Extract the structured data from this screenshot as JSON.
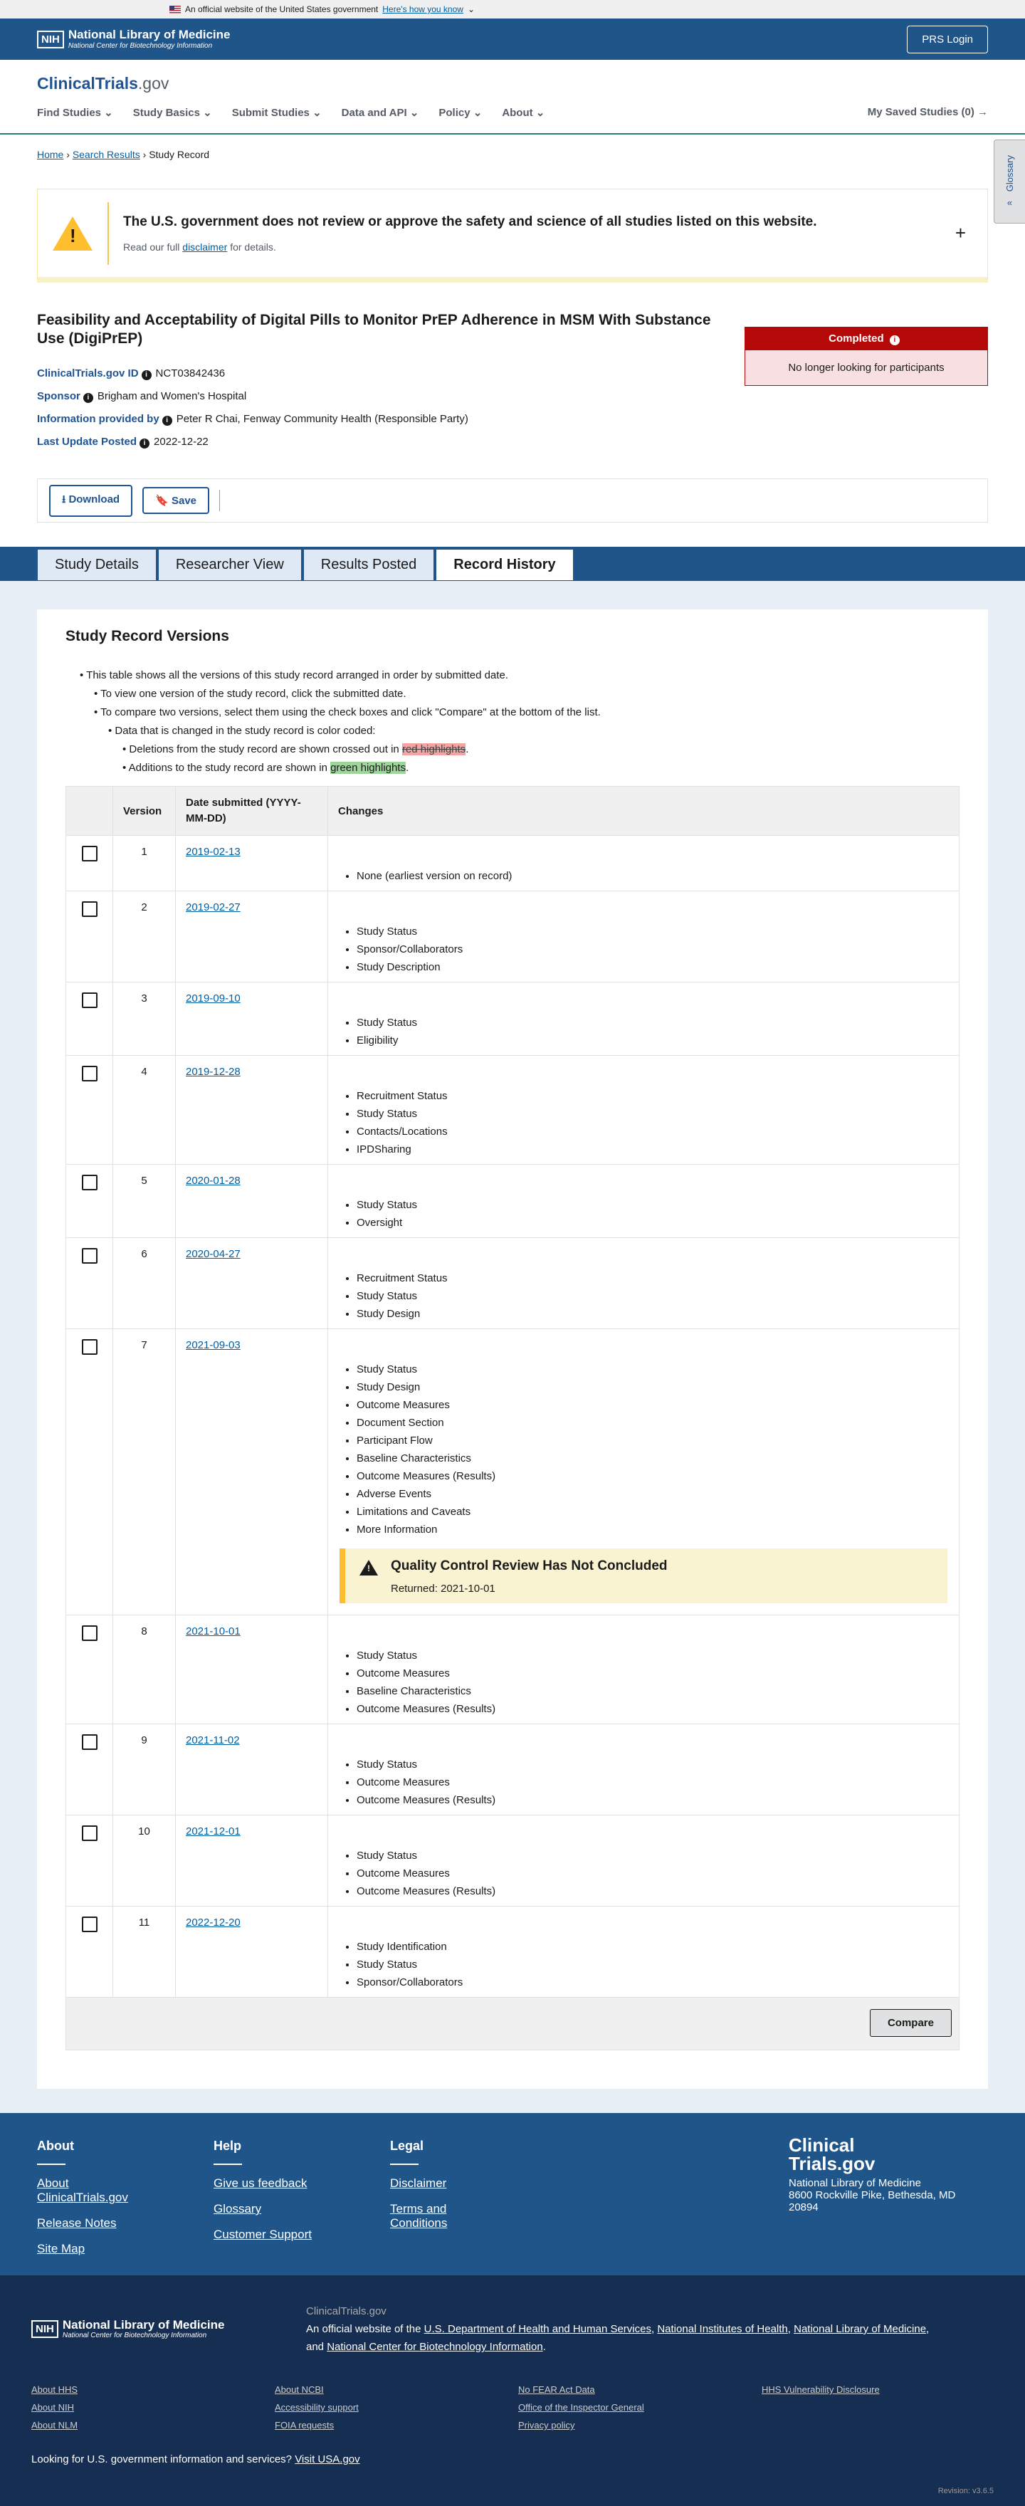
{
  "gov_banner": {
    "text": "An official website of the United States government",
    "link": "Here's how you know"
  },
  "nih": {
    "title": "National Library of Medicine",
    "subtitle": "National Center for Biotechnology Information",
    "logo": "NIH",
    "prs": "PRS Login"
  },
  "header": {
    "logo_main": "ClinicalTrials",
    "logo_suffix": ".gov",
    "nav": [
      "Find Studies",
      "Study Basics",
      "Submit Studies",
      "Data and API",
      "Policy",
      "About"
    ],
    "saved": "My Saved Studies (0)"
  },
  "breadcrumb": {
    "home": "Home",
    "search": "Search Results",
    "current": "Study Record"
  },
  "glossary": "Glossary",
  "warning": {
    "title": "The U.S. government does not review or approve the safety and science of all studies listed on this website.",
    "pre": "Read our full",
    "link": "disclaimer",
    "post": "for details."
  },
  "study": {
    "title": "Feasibility and Acceptability of Digital Pills to Monitor PrEP Adherence in MSM With Substance Use (DigiPrEP)",
    "id_label": "ClinicalTrials.gov ID",
    "id": "NCT03842436",
    "sponsor_label": "Sponsor",
    "sponsor": "Brigham and Women's Hospital",
    "info_label": "Information provided by",
    "info": "Peter R Chai, Fenway Community Health (Responsible Party)",
    "update_label": "Last Update Posted",
    "update": "2022-12-22",
    "status": "Completed",
    "status_sub": "No longer looking for participants"
  },
  "actions": {
    "download": "Download",
    "save": "Save"
  },
  "tabs": [
    "Study Details",
    "Researcher View",
    "Results Posted",
    "Record History"
  ],
  "versions": {
    "heading": "Study Record Versions",
    "b1": "This table shows all the versions of this study record arranged in order by submitted date.",
    "b2": "To view one version of the study record, click the submitted date.",
    "b3": "To compare two versions, select them using the check boxes and click \"Compare\" at the bottom of the list.",
    "b4": "Data that is changed in the study record is color coded:",
    "b5_pre": "Deletions from the study record are shown crossed out in",
    "b5_hl": "red highlights",
    "b6_pre": "Additions to the study record are shown in",
    "b6_hl": "green highlights",
    "col_version": "Version",
    "col_date": "Date submitted (YYYY-MM-DD)",
    "col_changes": "Changes",
    "rows": [
      {
        "v": "1",
        "date": "2019-02-13",
        "changes": [
          "None (earliest version on record)"
        ]
      },
      {
        "v": "2",
        "date": "2019-02-27",
        "changes": [
          "Study Status",
          "Sponsor/Collaborators",
          "Study Description"
        ]
      },
      {
        "v": "3",
        "date": "2019-09-10",
        "changes": [
          "Study Status",
          "Eligibility"
        ]
      },
      {
        "v": "4",
        "date": "2019-12-28",
        "changes": [
          "Recruitment Status",
          "Study Status",
          "Contacts/Locations",
          "IPDSharing"
        ]
      },
      {
        "v": "5",
        "date": "2020-01-28",
        "changes": [
          "Study Status",
          "Oversight"
        ]
      },
      {
        "v": "6",
        "date": "2020-04-27",
        "changes": [
          "Recruitment Status",
          "Study Status",
          "Study Design"
        ]
      },
      {
        "v": "7",
        "date": "2021-09-03",
        "changes": [
          "Study Status",
          "Study Design",
          "Outcome Measures",
          "Document Section",
          "Participant Flow",
          "Baseline Characteristics",
          "Outcome Measures (Results)",
          "Adverse Events",
          "Limitations and Caveats",
          "More Information"
        ],
        "qc": {
          "title": "Quality Control Review Has Not Concluded",
          "sub": "Returned: 2021-10-01"
        }
      },
      {
        "v": "8",
        "date": "2021-10-01",
        "changes": [
          "Study Status",
          "Outcome Measures",
          "Baseline Characteristics",
          "Outcome Measures (Results)"
        ]
      },
      {
        "v": "9",
        "date": "2021-11-02",
        "changes": [
          "Study Status",
          "Outcome Measures",
          "Outcome Measures (Results)"
        ]
      },
      {
        "v": "10",
        "date": "2021-12-01",
        "changes": [
          "Study Status",
          "Outcome Measures",
          "Outcome Measures (Results)"
        ]
      },
      {
        "v": "11",
        "date": "2022-12-20",
        "changes": [
          "Study Identification",
          "Study Status",
          "Sponsor/Collaborators"
        ]
      }
    ],
    "compare": "Compare"
  },
  "footer": {
    "cols": [
      {
        "h": "About",
        "links": [
          "About ClinicalTrials.gov",
          "Release Notes",
          "Site Map"
        ]
      },
      {
        "h": "Help",
        "links": [
          "Give us feedback",
          "Glossary",
          "Customer Support"
        ]
      },
      {
        "h": "Legal",
        "links": [
          "Disclaimer",
          "Terms and Conditions"
        ]
      }
    ],
    "logo1": "Clinical",
    "logo2": "Trials.gov",
    "addr1": "National Library of Medicine",
    "addr2": "8600 Rockville Pike, Bethesda, MD 20894"
  },
  "footer2": {
    "site": "ClinicalTrials.gov",
    "official_pre": "An official website of the",
    "l1": "U.S. Department of Health and Human Services",
    "l2": "National Institutes of Health",
    "l3": "National Library of Medicine",
    "and": "and",
    "l4": "National Center for Biotechnology Information",
    "links": [
      "About HHS",
      "About NCBI",
      "No FEAR Act Data",
      "HHS Vulnerability Disclosure",
      "About NIH",
      "Accessibility support",
      "Office of the Inspector General",
      "",
      "About NLM",
      "FOIA requests",
      "Privacy policy",
      ""
    ],
    "usa_pre": "Looking for U.S. government information and services?",
    "usa_link": "Visit USA.gov",
    "revision": "Revision: v3.6.5"
  }
}
